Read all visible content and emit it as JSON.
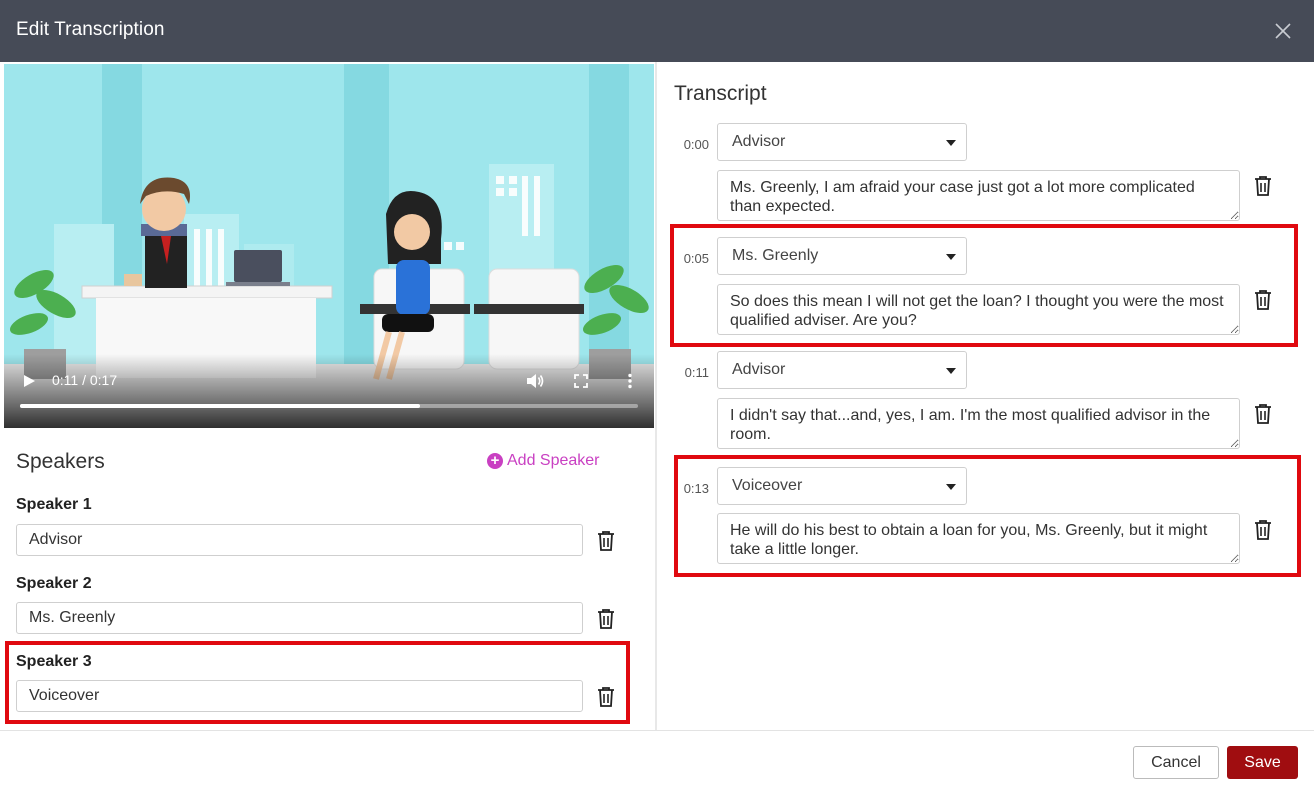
{
  "dialog": {
    "title": "Edit Transcription"
  },
  "video": {
    "time_readout": "0:11 / 0:17",
    "progress": 0.647
  },
  "speakers": {
    "title": "Speakers",
    "add_label": "Add Speaker",
    "items": [
      {
        "label": "Speaker 1",
        "value": "Advisor"
      },
      {
        "label": "Speaker 2",
        "value": "Ms. Greenly"
      },
      {
        "label": "Speaker 3",
        "value": "Voiceover"
      }
    ]
  },
  "transcript": {
    "title": "Transcript",
    "entries": [
      {
        "time": "0:00",
        "speaker": "Advisor",
        "text": "Ms. Greenly, I am afraid your case just got a lot more complicated than expected."
      },
      {
        "time": "0:05",
        "speaker": "Ms. Greenly",
        "text": "So does this mean I will not get the loan? I thought you were the most qualified adviser. Are you?"
      },
      {
        "time": "0:11",
        "speaker": "Advisor",
        "text": "I didn't say that...and, yes, I am. I'm the most qualified advisor in the room."
      },
      {
        "time": "0:13",
        "speaker": "Voiceover",
        "text": "He will do his best to obtain a loan for you, Ms. Greenly, but it might take a little longer."
      }
    ]
  },
  "footer": {
    "cancel_label": "Cancel",
    "save_label": "Save"
  },
  "colors": {
    "header_bg": "#464b57",
    "accent_magenta": "#c940c2",
    "save_bg": "#a00d10",
    "highlight_red": "#e0090f"
  },
  "icons": {
    "close": "close-icon",
    "play": "play-icon",
    "volume": "volume-icon",
    "fullscreen": "fullscreen-icon",
    "more": "more-vertical-icon",
    "add": "plus-circle-icon",
    "delete": "trash-icon",
    "dropdown": "chevron-down-icon"
  }
}
